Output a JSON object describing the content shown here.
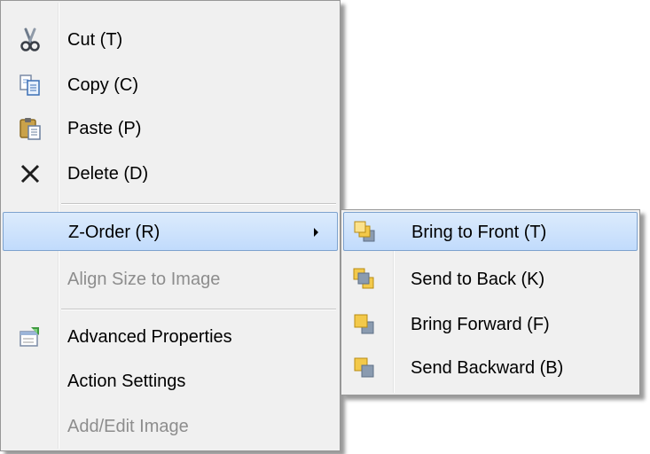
{
  "context_menu": {
    "items": [
      {
        "label": "Cut (T)",
        "icon": "scissors-icon"
      },
      {
        "label": "Copy (C)",
        "icon": "copy-icon"
      },
      {
        "label": "Paste (P)",
        "icon": "paste-icon"
      },
      {
        "label": "Delete (D)",
        "icon": "delete-x-icon"
      },
      {
        "label": "Z-Order (R)",
        "has_submenu": true,
        "highlighted": true
      },
      {
        "label": "Align Size to Image",
        "disabled": true
      },
      {
        "label": "Advanced Properties",
        "icon": "properties-icon"
      },
      {
        "label": "Action Settings"
      },
      {
        "label": "Add/Edit Image",
        "disabled": true
      }
    ]
  },
  "zorder_submenu": {
    "items": [
      {
        "label": "Bring to Front (T)",
        "icon": "bring-to-front-icon",
        "highlighted": true
      },
      {
        "label": "Send to Back (K)",
        "icon": "send-to-back-icon"
      },
      {
        "label": "Bring Forward (F)",
        "icon": "bring-forward-icon"
      },
      {
        "label": "Send Backward (B)",
        "icon": "send-backward-icon"
      }
    ]
  },
  "colors": {
    "menu_background": "#f0f0f0",
    "highlight_top": "#dcebfc",
    "highlight_bottom": "#c1dbfc",
    "highlight_border": "#7da2ce",
    "disabled_text": "#8d8d8d"
  }
}
